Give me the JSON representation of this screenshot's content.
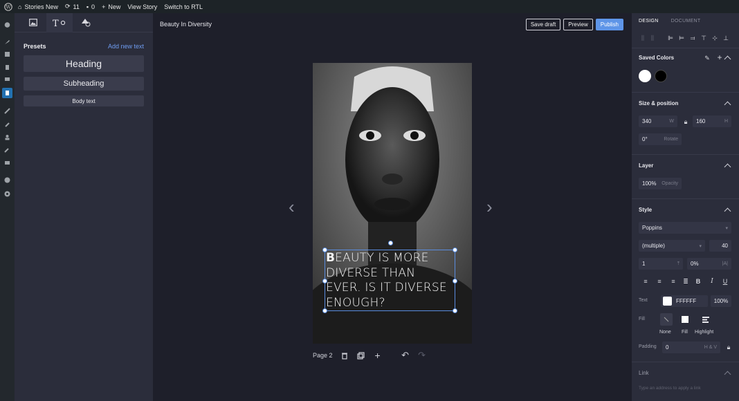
{
  "adminbar": {
    "site_name": "Stories New",
    "updates_count": "11",
    "comments_count": "0",
    "new_label": "New",
    "view_story": "View Story",
    "rtl": "Switch to RTL"
  },
  "library": {
    "presets_title": "Presets",
    "add_new_text": "Add new text",
    "presets": [
      "Heading",
      "Subheading",
      "Body text"
    ]
  },
  "canvas": {
    "story_title": "Beauty In Diversity",
    "buttons": {
      "save_draft": "Save draft",
      "preview": "Preview",
      "publish": "Publish"
    },
    "page_label": "Page 2",
    "text_lines": [
      "BEAUTY IS MORE",
      "DIVERSE THAN",
      "EVER. IS IT DIVERSE",
      "ENOUGH?"
    ]
  },
  "inspector": {
    "tabs": {
      "design": "DESIGN",
      "document": "DOCUMENT"
    },
    "saved_colors": {
      "title": "Saved Colors",
      "colors": [
        "#ffffff",
        "#000000"
      ]
    },
    "size_position": {
      "title": "Size & position",
      "width": "340",
      "width_suffix": "W",
      "height": "160",
      "height_suffix": "H",
      "rotate": "0°",
      "rotate_label": "Rotate"
    },
    "layer": {
      "title": "Layer",
      "opacity": "100%",
      "opacity_label": "Opacity"
    },
    "style": {
      "title": "Style",
      "font": "Poppins",
      "weight": "(multiple)",
      "size": "40",
      "line_height": "1",
      "letter_spacing": "0%",
      "text_label": "Text",
      "text_color": "FFFFFF",
      "text_opacity": "100%",
      "fill_label": "Fill",
      "fill_options": [
        "None",
        "Fill",
        "Highlight"
      ],
      "padding_label": "Padding",
      "padding_value": "0",
      "padding_suffix": "H & V"
    },
    "link": {
      "title": "Link",
      "placeholder": "Type an address to apply a link"
    }
  }
}
